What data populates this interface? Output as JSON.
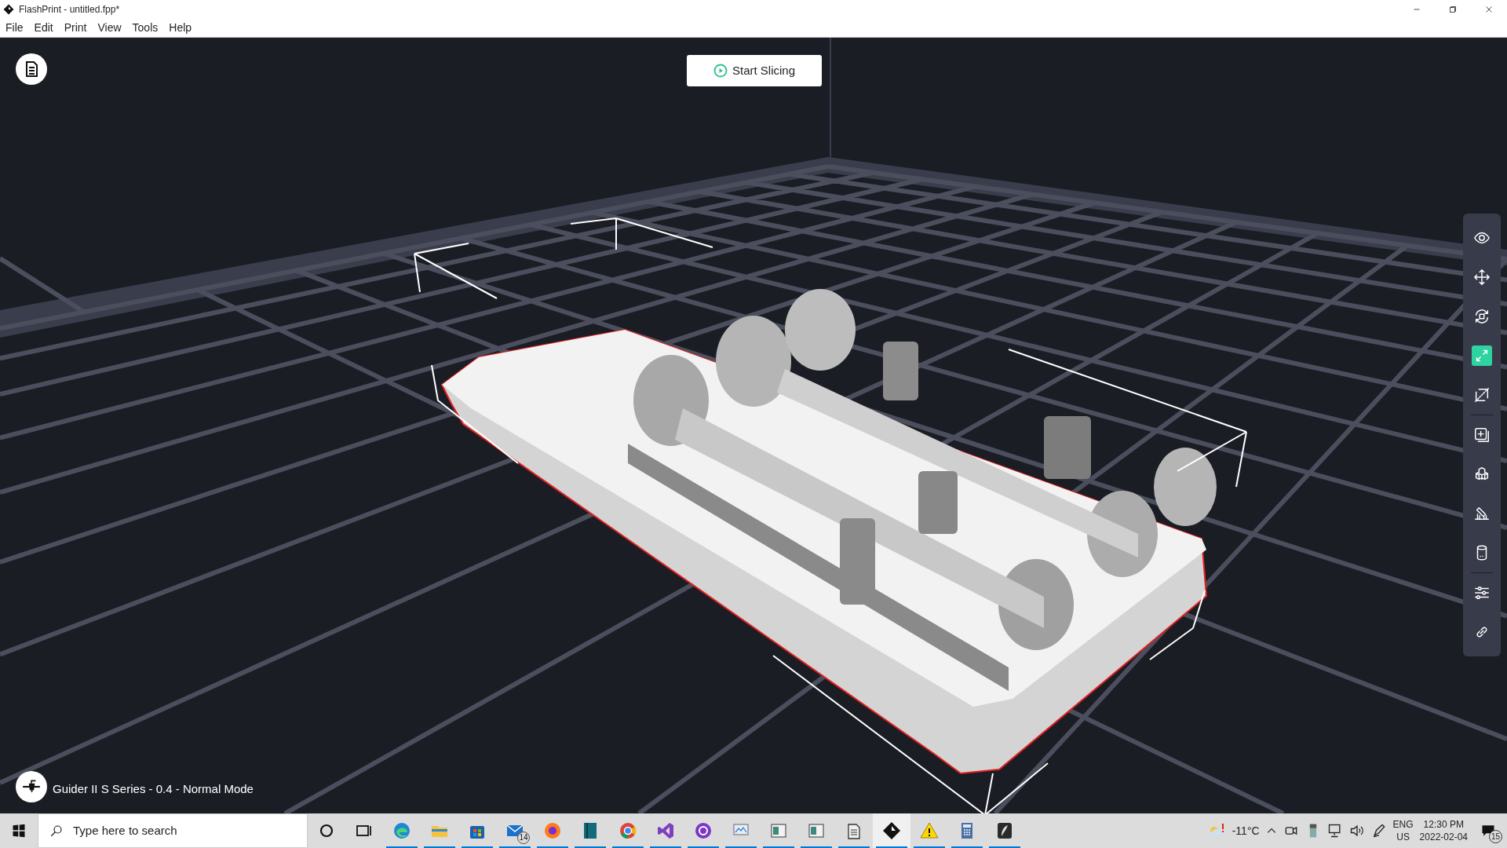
{
  "window": {
    "title": "FlashPrint - untitled.fpp*"
  },
  "menu": [
    "File",
    "Edit",
    "Print",
    "View",
    "Tools",
    "Help"
  ],
  "viewport": {
    "start_button": "Start Slicing",
    "printer_status": "Guider II S Series - 0.4 - Normal Mode"
  },
  "toolbar": {
    "groups": [
      [
        {
          "selected": false
        },
        {
          "selected": false
        },
        {
          "selected": false
        },
        {
          "selected": true
        },
        {
          "selected": false
        }
      ],
      [
        {
          "selected": false
        },
        {
          "selected": false
        },
        {
          "selected": false
        },
        {
          "selected": false
        }
      ],
      [
        {
          "selected": false
        },
        {
          "selected": false
        }
      ]
    ]
  },
  "taskbar": {
    "search": {
      "placeholder": "Type here to search"
    },
    "apps": [
      {
        "running": false,
        "selected": false
      },
      {
        "running": false,
        "selected": false
      },
      {
        "running": true,
        "selected": false
      },
      {
        "running": true,
        "selected": false
      },
      {
        "running": true,
        "selected": false
      },
      {
        "running": true,
        "selected": false,
        "badge": "14"
      },
      {
        "running": true,
        "selected": false
      },
      {
        "running": true,
        "selected": false
      },
      {
        "running": true,
        "selected": false
      },
      {
        "running": true,
        "selected": false
      },
      {
        "running": true,
        "selected": false
      },
      {
        "running": true,
        "selected": false
      },
      {
        "running": true,
        "selected": false
      },
      {
        "running": true,
        "selected": false
      },
      {
        "running": true,
        "selected": false
      },
      {
        "running": true,
        "selected": true
      },
      {
        "running": true,
        "selected": false
      },
      {
        "running": true,
        "selected": false
      },
      {
        "running": true,
        "selected": false
      }
    ],
    "tray": {
      "temperature": "-11°C",
      "language": "ENG",
      "region": "US",
      "time": "12:30 PM",
      "date": "2022-02-04",
      "notifications": "15"
    }
  }
}
